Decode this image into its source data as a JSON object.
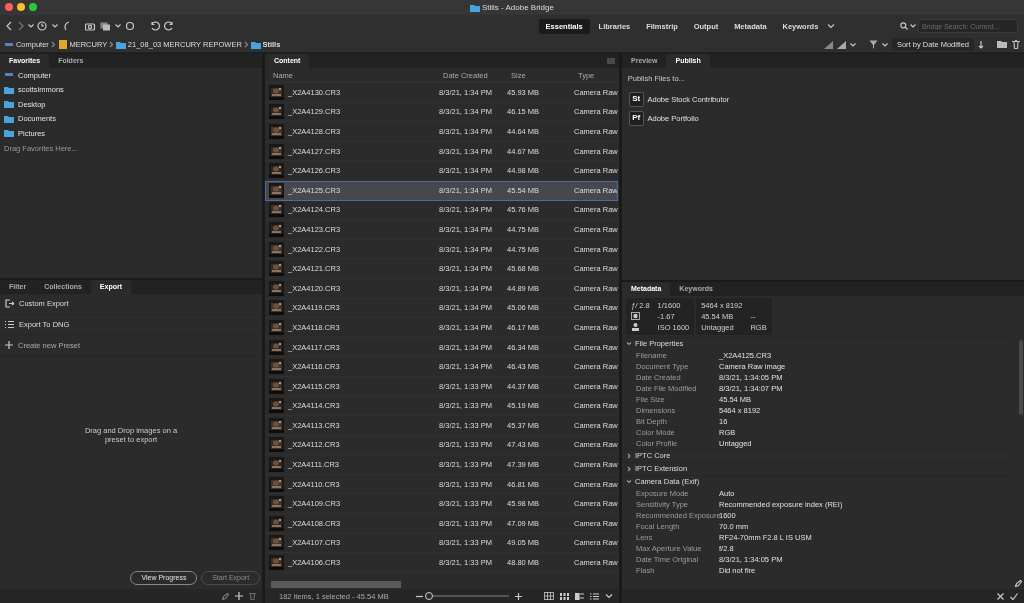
{
  "window": {
    "title": "Stills - Adobe Bridge"
  },
  "workspaces": [
    {
      "label": "Essentials",
      "selected": true
    },
    {
      "label": "Libraries",
      "selected": false
    },
    {
      "label": "Filmstrip",
      "selected": false
    },
    {
      "label": "Output",
      "selected": false
    },
    {
      "label": "Metadata",
      "selected": false
    },
    {
      "label": "Keywords",
      "selected": false
    }
  ],
  "search": {
    "placeholder": "Bridge Search: Current..."
  },
  "path": [
    {
      "label": "Computer",
      "kind": "computer"
    },
    {
      "label": "MERCURY",
      "kind": "drive"
    },
    {
      "label": "21_08_03 MERCURY REPOWER",
      "kind": "folder"
    },
    {
      "label": "Stills",
      "kind": "folder"
    }
  ],
  "sort": {
    "label": "Sort by Date Modified"
  },
  "favorites_panel": {
    "tabs": [
      {
        "label": "Favorites",
        "selected": true
      },
      {
        "label": "Folders",
        "selected": false
      }
    ],
    "items": [
      {
        "label": "Computer",
        "kind": "computer"
      },
      {
        "label": "scottsimmons",
        "kind": "home"
      },
      {
        "label": "Desktop",
        "kind": "folder"
      },
      {
        "label": "Documents",
        "kind": "folder"
      },
      {
        "label": "Pictures",
        "kind": "folder"
      }
    ],
    "hint": "Drag Favorites Here..."
  },
  "export_panel": {
    "tabs": [
      {
        "label": "Filter",
        "selected": false
      },
      {
        "label": "Collections",
        "selected": false
      },
      {
        "label": "Export",
        "selected": true
      }
    ],
    "presets": [
      {
        "label": "Custom Export",
        "kind": "export"
      },
      {
        "label": "Export To DNG",
        "kind": "list"
      },
      {
        "label": "Create new Preset",
        "kind": "add"
      }
    ],
    "hint": "Drag and Drop images on a preset to export",
    "buttons": [
      {
        "label": "View Progress",
        "disabled": false
      },
      {
        "label": "Start Export",
        "disabled": true
      }
    ]
  },
  "content_panel": {
    "tabs": [
      {
        "label": "Content",
        "selected": true
      }
    ],
    "columns": [
      "Name",
      "Date Created",
      "Size",
      "Type"
    ],
    "rows": [
      {
        "name": "_X2A4130.CR3",
        "date": "8/3/21, 1:34 PM",
        "size": "45.93 MB",
        "type": "Camera Raw",
        "selected": false
      },
      {
        "name": "_X2A4129.CR3",
        "date": "8/3/21, 1:34 PM",
        "size": "46.15 MB",
        "type": "Camera Raw",
        "selected": false
      },
      {
        "name": "_X2A4128.CR3",
        "date": "8/3/21, 1:34 PM",
        "size": "44.64 MB",
        "type": "Camera Raw",
        "selected": false
      },
      {
        "name": "_X2A4127.CR3",
        "date": "8/3/21, 1:34 PM",
        "size": "44.67 MB",
        "type": "Camera Raw",
        "selected": false
      },
      {
        "name": "_X2A4126.CR3",
        "date": "8/3/21, 1:34 PM",
        "size": "44.98 MB",
        "type": "Camera Raw",
        "selected": false
      },
      {
        "name": "_X2A4125.CR3",
        "date": "8/3/21, 1:34 PM",
        "size": "45.54 MB",
        "type": "Camera Raw",
        "selected": true
      },
      {
        "name": "_X2A4124.CR3",
        "date": "8/3/21, 1:34 PM",
        "size": "45.76 MB",
        "type": "Camera Raw",
        "selected": false
      },
      {
        "name": "_X2A4123.CR3",
        "date": "8/3/21, 1:34 PM",
        "size": "44.75 MB",
        "type": "Camera Raw",
        "selected": false
      },
      {
        "name": "_X2A4122.CR3",
        "date": "8/3/21, 1:34 PM",
        "size": "44.75 MB",
        "type": "Camera Raw",
        "selected": false
      },
      {
        "name": "_X2A4121.CR3",
        "date": "8/3/21, 1:34 PM",
        "size": "45.68 MB",
        "type": "Camera Raw",
        "selected": false
      },
      {
        "name": "_X2A4120.CR3",
        "date": "8/3/21, 1:34 PM",
        "size": "44.89 MB",
        "type": "Camera Raw",
        "selected": false
      },
      {
        "name": "_X2A4119.CR3",
        "date": "8/3/21, 1:34 PM",
        "size": "45.06 MB",
        "type": "Camera Raw",
        "selected": false
      },
      {
        "name": "_X2A4118.CR3",
        "date": "8/3/21, 1:34 PM",
        "size": "46.17 MB",
        "type": "Camera Raw",
        "selected": false
      },
      {
        "name": "_X2A4117.CR3",
        "date": "8/3/21, 1:34 PM",
        "size": "46.34 MB",
        "type": "Camera Raw",
        "selected": false
      },
      {
        "name": "_X2A4116.CR3",
        "date": "8/3/21, 1:34 PM",
        "size": "46.43 MB",
        "type": "Camera Raw",
        "selected": false
      },
      {
        "name": "_X2A4115.CR3",
        "date": "8/3/21, 1:33 PM",
        "size": "44.37 MB",
        "type": "Camera Raw",
        "selected": false
      },
      {
        "name": "_X2A4114.CR3",
        "date": "8/3/21, 1:33 PM",
        "size": "45.19 MB",
        "type": "Camera Raw",
        "selected": false
      },
      {
        "name": "_X2A4113.CR3",
        "date": "8/3/21, 1:33 PM",
        "size": "45.37 MB",
        "type": "Camera Raw",
        "selected": false
      },
      {
        "name": "_X2A4112.CR3",
        "date": "8/3/21, 1:33 PM",
        "size": "47.43 MB",
        "type": "Camera Raw",
        "selected": false
      },
      {
        "name": "_X2A4111.CR3",
        "date": "8/3/21, 1:33 PM",
        "size": "47.39 MB",
        "type": "Camera Raw",
        "selected": false
      },
      {
        "name": "_X2A4110.CR3",
        "date": "8/3/21, 1:33 PM",
        "size": "46.81 MB",
        "type": "Camera Raw",
        "selected": false
      },
      {
        "name": "_X2A4109.CR3",
        "date": "8/3/21, 1:33 PM",
        "size": "45.98 MB",
        "type": "Camera Raw",
        "selected": false
      },
      {
        "name": "_X2A4108.CR3",
        "date": "8/3/21, 1:33 PM",
        "size": "47.09 MB",
        "type": "Camera Raw",
        "selected": false
      },
      {
        "name": "_X2A4107.CR3",
        "date": "8/3/21, 1:33 PM",
        "size": "49.05 MB",
        "type": "Camera Raw",
        "selected": false
      },
      {
        "name": "_X2A4106.CR3",
        "date": "8/3/21, 1:33 PM",
        "size": "48.80 MB",
        "type": "Camera Raw",
        "selected": false
      }
    ],
    "status": "182 items, 1 selected - 45.54 MB",
    "thumbnail_size": {
      "level": 0
    }
  },
  "publish_panel": {
    "tabs": [
      {
        "label": "Preview",
        "selected": false
      },
      {
        "label": "Publish",
        "selected": true
      }
    ],
    "heading": "Publish Files to...",
    "services": [
      {
        "logo": "St",
        "label": "Adobe Stock Contributor"
      },
      {
        "logo": "Pf",
        "label": "Adobe Portfolio"
      }
    ]
  },
  "metadata_panel": {
    "tabs": [
      {
        "label": "Metadata",
        "selected": true
      },
      {
        "label": "Keywords",
        "selected": false
      }
    ],
    "summary": {
      "aperture_symbol": "ƒ/",
      "aperture": "2.8",
      "shutter": "1/1600",
      "exposure": "-1.67",
      "iso": "ISO 1600",
      "dimensions": "5464 x 8192",
      "file_size": "45.54 MB",
      "resolution": "--",
      "color_profile": "Untagged",
      "color_mode": "RGB"
    },
    "sections": [
      {
        "title": "File Properties",
        "expanded": true,
        "fields": [
          {
            "label": "Filename",
            "value": "_X2A4125.CR3"
          },
          {
            "label": "Document Type",
            "value": "Camera Raw image"
          },
          {
            "label": "Date Created",
            "value": "8/3/21, 1:34:05 PM"
          },
          {
            "label": "Date File Modified",
            "value": "8/3/21, 1:34:07 PM"
          },
          {
            "label": "File Size",
            "value": "45.54 MB"
          },
          {
            "label": "Dimensions",
            "value": "5464 x 8192"
          },
          {
            "label": "Bit Depth",
            "value": "16"
          },
          {
            "label": "Color Mode",
            "value": "RGB"
          },
          {
            "label": "Color Profile",
            "value": "Untagged"
          }
        ]
      },
      {
        "title": "IPTC Core",
        "expanded": false
      },
      {
        "title": "IPTC Extension",
        "expanded": false
      },
      {
        "title": "Camera Data (Exif)",
        "expanded": true,
        "fields": [
          {
            "label": "Exposure Mode",
            "value": "Auto"
          },
          {
            "label": "Sensitivity Type",
            "value": "Recommended exposure index (REI)"
          },
          {
            "label": "Recommended Exposure",
            "value": "1600"
          },
          {
            "label": "Focal Length",
            "value": "70.0 mm"
          },
          {
            "label": "Lens",
            "value": "RF24-70mm F2.8 L IS USM"
          },
          {
            "label": "Max Aperture Value",
            "value": "f/2.8"
          },
          {
            "label": "Date Time Original",
            "value": "8/3/21, 1:34:05 PM"
          },
          {
            "label": "Flash",
            "value": "Did not fire"
          }
        ]
      }
    ]
  }
}
